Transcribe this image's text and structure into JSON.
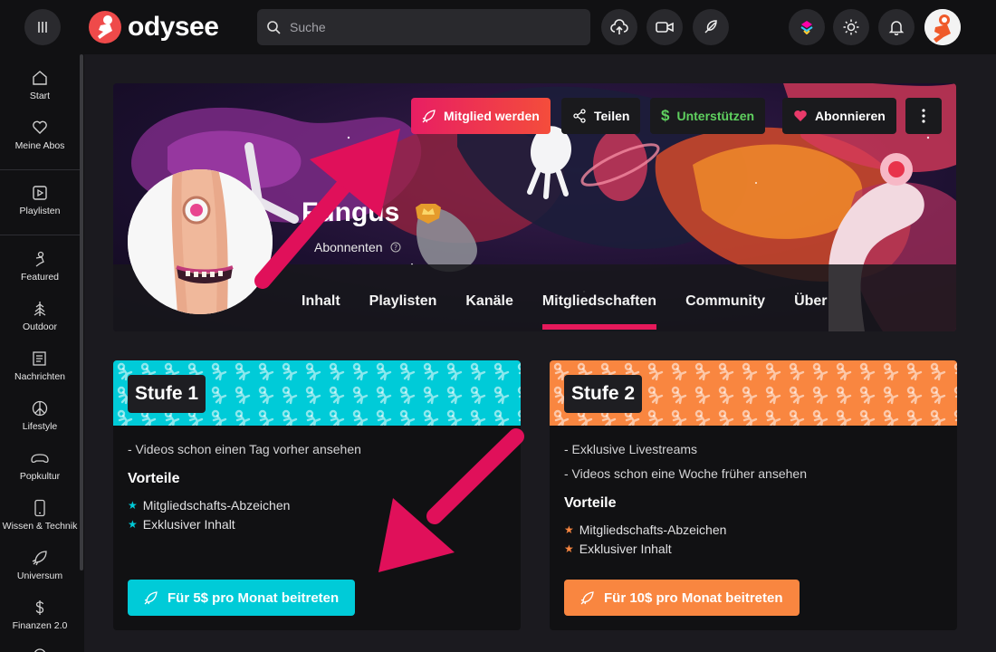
{
  "header": {
    "brand": "odysee",
    "search_placeholder": "Suche"
  },
  "sidebar": {
    "items": [
      {
        "label": "Start",
        "icon": "home-icon"
      },
      {
        "label": "Meine Abos",
        "icon": "heart-icon"
      },
      {
        "label": "Playlisten",
        "icon": "playlist-icon"
      },
      {
        "label": "Featured",
        "icon": "featured-icon"
      },
      {
        "label": "Outdoor",
        "icon": "outdoor-icon"
      },
      {
        "label": "Nachrichten",
        "icon": "news-icon"
      },
      {
        "label": "Lifestyle",
        "icon": "lifestyle-icon"
      },
      {
        "label": "Popkultur",
        "icon": "popculture-icon"
      },
      {
        "label": "Wissen & Technik",
        "icon": "phone-icon"
      },
      {
        "label": "Universum",
        "icon": "rocket-icon"
      },
      {
        "label": "Finanzen 2.0",
        "icon": "dollar-icon"
      }
    ]
  },
  "channel": {
    "name": "Fungus",
    "subscribers": "Abonnenten",
    "buttons": {
      "join": "Mitglied werden",
      "share": "Teilen",
      "support": "Unterstützen",
      "follow": "Abonnieren"
    },
    "tabs": [
      "Inhalt",
      "Playlisten",
      "Kanäle",
      "Mitgliedschaften",
      "Community",
      "Über"
    ],
    "active_tab": "Mitgliedschaften"
  },
  "tiers": [
    {
      "title": "Stufe 1",
      "color": "#00cbd8",
      "description": [
        "- Videos schon einen Tag vorher ansehen"
      ],
      "perks_heading": "Vorteile",
      "perks": [
        "Mitgliedschafts-Abzeichen",
        "Exklusiver Inhalt"
      ],
      "button": "Für 5$ pro Monat beitreten"
    },
    {
      "title": "Stufe 2",
      "color": "#f98640",
      "description": [
        "- Exklusive Livestreams",
        "- Videos schon eine Woche früher ansehen"
      ],
      "perks_heading": "Vorteile",
      "perks": [
        "Mitgliedschafts-Abzeichen",
        "Exklusiver Inhalt"
      ],
      "button": "Für 10$ pro Monat beitreten"
    }
  ],
  "colors": {
    "accent": "#e6195b",
    "tier1": "#00cbd8",
    "tier2": "#f98640",
    "support_green": "#5fd05f"
  }
}
